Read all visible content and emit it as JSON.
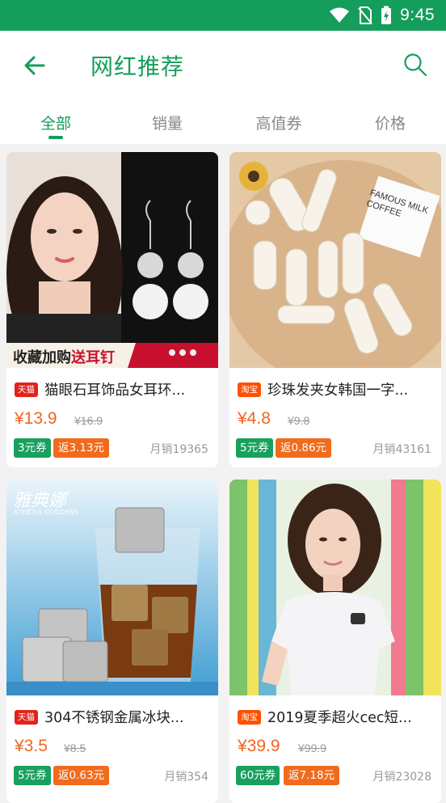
{
  "status_bar": {
    "time": "9:45"
  },
  "header": {
    "title": "网红推荐"
  },
  "tabs": [
    {
      "label": "全部"
    },
    {
      "label": "销量"
    },
    {
      "label": "高值券"
    },
    {
      "label": "价格"
    }
  ],
  "products": [
    {
      "badge": "天猫",
      "name": "猫眼石耳饰品女耳环...",
      "price": "¥13.9",
      "original_price": "¥16.9",
      "coupon": "3元券",
      "rebate": "返3.13元",
      "sales": "月销19365",
      "banner_text_a": "收藏加购",
      "banner_text_b": "送耳钉"
    },
    {
      "badge": "淘宝",
      "name": "珍珠发夹女韩国一字...",
      "price": "¥4.8",
      "original_price": "¥9.8",
      "coupon": "5元券",
      "rebate": "返0.86元",
      "sales": "月销43161",
      "sign_text": "FAMOUS MILK COFFEE"
    },
    {
      "badge": "天猫",
      "name": "304不锈钢金属冰块...",
      "price": "¥3.5",
      "original_price": "¥8.5",
      "coupon": "5元券",
      "rebate": "返0.63元",
      "sales": "月销354",
      "brand_text": "雅典娜",
      "brand_sub": "ATHENA GODDESS"
    },
    {
      "badge": "淘宝",
      "name": "2019夏季超火cec短...",
      "price": "¥39.9",
      "original_price": "¥99.9",
      "coupon": "60元券",
      "rebate": "返7.18元",
      "sales": "月销23028"
    }
  ],
  "colors": {
    "brand_green": "#159d5b",
    "price_orange": "#f26522",
    "rebate_orange": "#f06b1d"
  }
}
